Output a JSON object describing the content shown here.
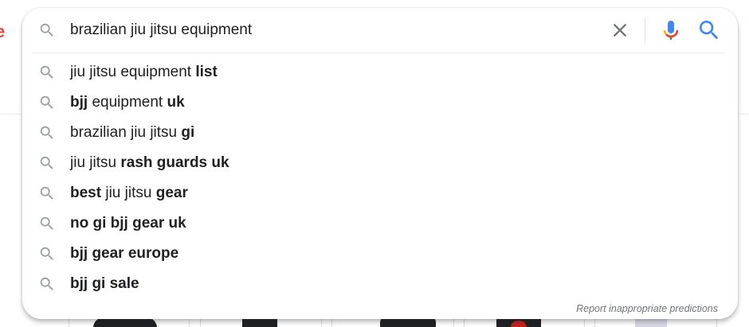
{
  "search": {
    "query": "brazilian jiu jitsu equipment",
    "suggestions": [
      {
        "parts": [
          {
            "text": "jiu jitsu equipment ",
            "bold": false
          },
          {
            "text": "list",
            "bold": true
          }
        ]
      },
      {
        "parts": [
          {
            "text": "bjj",
            "bold": true
          },
          {
            "text": " equipment ",
            "bold": false
          },
          {
            "text": "uk",
            "bold": true
          }
        ]
      },
      {
        "parts": [
          {
            "text": "brazilian jiu jitsu ",
            "bold": false
          },
          {
            "text": "gi",
            "bold": true
          }
        ]
      },
      {
        "parts": [
          {
            "text": "jiu jitsu ",
            "bold": false
          },
          {
            "text": "rash guards uk",
            "bold": true
          }
        ]
      },
      {
        "parts": [
          {
            "text": "best",
            "bold": true
          },
          {
            "text": " jiu jitsu ",
            "bold": false
          },
          {
            "text": "gear",
            "bold": true
          }
        ]
      },
      {
        "parts": [
          {
            "text": "no gi bjj gear uk",
            "bold": true
          }
        ]
      },
      {
        "parts": [
          {
            "text": "bjj gear europe",
            "bold": true
          }
        ]
      },
      {
        "parts": [
          {
            "text": "bjj gi sale",
            "bold": true
          }
        ]
      }
    ],
    "report_label": "Report inappropriate predictions",
    "icons": {
      "search": "search-icon",
      "clear": "close-icon",
      "voice": "microphone-icon",
      "submit": "search-icon"
    }
  },
  "colors": {
    "google_blue": "#4285f4",
    "google_red": "#ea4335",
    "google_yellow": "#fbbc05",
    "google_green": "#34a853",
    "icon_gray": "#9aa0a6",
    "text": "#202124"
  }
}
